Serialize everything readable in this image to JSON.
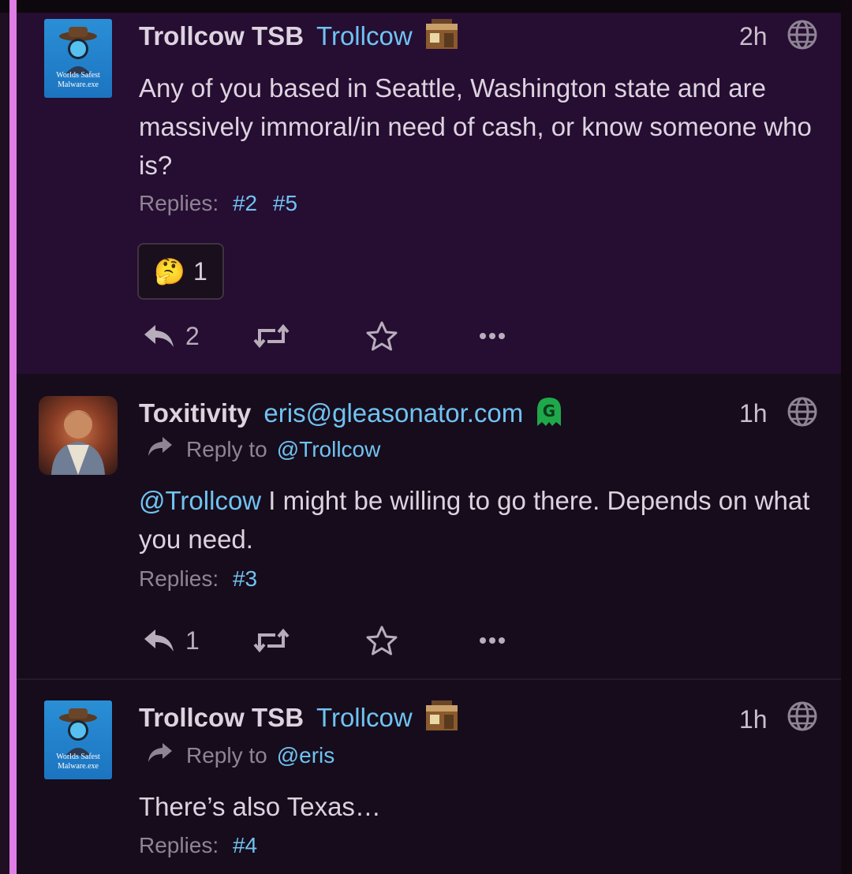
{
  "posts": [
    {
      "display_name": "Trollcow TSB",
      "handle": "Trollcow",
      "time": "2h",
      "avatar_caption": "Worlds Safest Malware.exe",
      "body": "Any of you based in Seattle, Washington state and are massively immoral/in need of cash, or know someone who is?",
      "replies_label": "Replies:",
      "reply_links": [
        "#2",
        "#5"
      ],
      "reaction": {
        "emoji": "🤔",
        "count": "1"
      },
      "actions": {
        "reply_count": "2",
        "reply_icon": "reply-icon",
        "repost_icon": "repost-icon",
        "favorite_icon": "star-icon",
        "more_icon": "more-icon"
      }
    },
    {
      "display_name": "Toxitivity",
      "handle": "eris@gleasonator.com",
      "time": "1h",
      "reply_to_label": "Reply to",
      "reply_to_target": "@Trollcow",
      "mention": "@Trollcow",
      "body": " I might be willing to go there. Depends on what you need.",
      "replies_label": "Replies:",
      "reply_links": [
        "#3"
      ],
      "actions": {
        "reply_count": "1"
      }
    },
    {
      "display_name": "Trollcow TSB",
      "handle": "Trollcow",
      "time": "1h",
      "avatar_caption": "Worlds Safest Malware.exe",
      "reply_to_label": "Reply to",
      "reply_to_target": "@eris",
      "body": "There’s also Texas…",
      "replies_label": "Replies:",
      "reply_links": [
        "#4"
      ]
    }
  ],
  "colors": {
    "accent": "#e07ee8",
    "link": "#6fc3f2",
    "highlight_bg": "#260d32",
    "bg": "#170c1b"
  }
}
